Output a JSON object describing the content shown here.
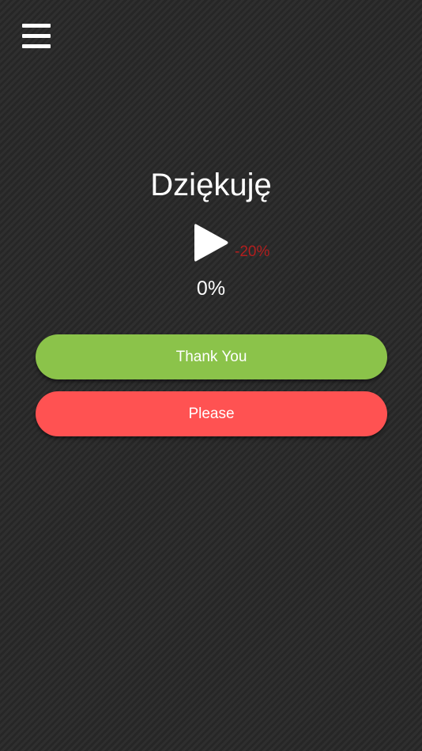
{
  "menu": {
    "icon": "hamburger-menu-icon"
  },
  "card": {
    "word": "Dziękuję",
    "play_icon": "play-icon",
    "speed_label": "-20%",
    "progress_label": "0%"
  },
  "answers": [
    {
      "label": "Thank You",
      "color": "#8bc34a"
    },
    {
      "label": "Please",
      "color": "#ff5252"
    }
  ],
  "colors": {
    "background": "#2d2d2d",
    "text": "#ffffff",
    "speed": "#b21e1e"
  }
}
